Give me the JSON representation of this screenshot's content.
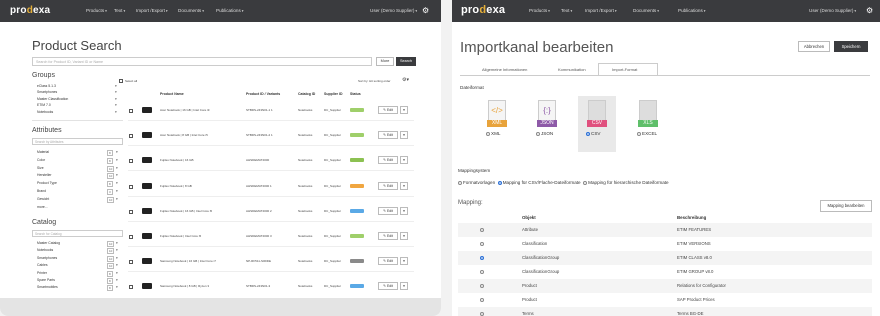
{
  "left": {
    "nav": {
      "logo_a": "pro",
      "logo_b": "d",
      "logo_c": "exa",
      "items": [
        "Products",
        "Text",
        "Import /Export",
        "Documents",
        "Publications"
      ],
      "user": "User (Demo Supplier)"
    },
    "title": "Product Search",
    "search_placeholder": "Search for Product ID, Variant ID or Name",
    "more_label": "More",
    "search_label": "Search",
    "groups_title": "Groups",
    "groups": [
      "eClass 5.1.3",
      "Smartphones",
      "Master Classification",
      "ETIM 7.0",
      "Notebooks"
    ],
    "attributes_title": "Attributes",
    "attr_search_placeholder": "Search by Attributes",
    "attributes": [
      {
        "name": "Material",
        "count": "8"
      },
      {
        "name": "Color",
        "count": "8"
      },
      {
        "name": "Size",
        "count": "10"
      },
      {
        "name": "Hersteller",
        "count": "10"
      },
      {
        "name": "Product Type",
        "count": "8"
      },
      {
        "name": "Brand",
        "count": "3"
      },
      {
        "name": "Gewicht",
        "count": "10"
      },
      {
        "name": "more...",
        "count": ""
      }
    ],
    "catalog_title": "Catalog",
    "catalog_search_placeholder": "Search for Catalog",
    "catalog": [
      {
        "name": "Master Catalog",
        "count": "10"
      },
      {
        "name": "Notebooks",
        "count": "10"
      },
      {
        "name": "Smartphones",
        "count": "10"
      },
      {
        "name": "Cables",
        "count": "10"
      },
      {
        "name": "Printer",
        "count": "8"
      },
      {
        "name": "Spare Parts",
        "count": "8"
      },
      {
        "name": "Smartmobiles",
        "count": "8"
      }
    ],
    "select_all": "Select all",
    "sort_label": "Sort by: Hit sorting order",
    "columns": {
      "name": "Product Name",
      "id": "Product ID / Variants",
      "catalog": "Catalog ID",
      "supplier": "Supplier ID",
      "status": "Status"
    },
    "rows": [
      {
        "name": "Acer Notebook | 16 GB | Intel Core i9",
        "id": "STBDS-243N01-1 1",
        "catalog": "Notebooks",
        "supplier": "DC_Supplier",
        "status_color": "#9fcf6a",
        "edit": "Edit"
      },
      {
        "name": "Acer Notebook | 8 GB | Intel Core i5",
        "id": "STBDS-243N01-2 1",
        "catalog": "Notebooks",
        "supplier": "DC_Supplier",
        "status_color": "#9fcf6a",
        "edit": "Edit"
      },
      {
        "name": "Fujitsu Notebook | 16 GB",
        "id": "AHSDEMAT2000",
        "catalog": "Notebooks",
        "supplier": "DC_Supplier",
        "status_color": "#8cc152",
        "edit": "Edit"
      },
      {
        "name": "Fujitsu Notebook | 8 GB",
        "id": "AHSDEMAT2000 1",
        "catalog": "Notebooks",
        "supplier": "DC_Supplier",
        "status_color": "#f0a640",
        "edit": "Edit"
      },
      {
        "name": "Fujitsu Notebook | 16 GB | Intel Core i5",
        "id": "AHSDEMAT2000 2",
        "catalog": "Notebooks",
        "supplier": "DC_Supplier",
        "status_color": "#5aa9e6",
        "edit": "Edit"
      },
      {
        "name": "Fujitsu Notebook | Intel Core i5",
        "id": "AHSDEMAT2000 3",
        "catalog": "Notebooks",
        "supplier": "DC_Supplier",
        "status_color": "#9fcf6a",
        "edit": "Edit"
      },
      {
        "name": "Samsung Notebook | 16 GB | Intel Core i7",
        "id": "NP-RF511-S0DDE",
        "catalog": "Notebooks",
        "supplier": "DC_Supplier",
        "status_color": "#8a8a8a",
        "edit": "Edit"
      },
      {
        "name": "Samsung Notebook | 8 GB | Ryzen 3",
        "id": "STBDS-243N01-3",
        "catalog": "Notebooks",
        "supplier": "DC_Supplier",
        "status_color": "#5aa9e6",
        "edit": "Edit"
      }
    ]
  },
  "right": {
    "nav": {
      "logo_a": "pro",
      "logo_b": "d",
      "logo_c": "exa",
      "items": [
        "Products",
        "Text",
        "Import /Export",
        "Documents",
        "Publications"
      ],
      "user": "User (Demo Supplier)"
    },
    "title": "Importkanal bearbeiten",
    "cancel_label": "Abbrechen",
    "save_label": "Speichern",
    "tabs": [
      "Allgemeine Informationen",
      "Kommunikation",
      "Import-Format"
    ],
    "dateiformat_label": "Dateiformat",
    "formats": [
      {
        "icon": "</>",
        "badge": "XML",
        "label": "XML",
        "color": "#e8a33b",
        "selected": false
      },
      {
        "icon": "{:}",
        "badge": "JSON",
        "label": "JSON",
        "color": "#8e5aa8",
        "selected": false
      },
      {
        "icon": "",
        "badge": "CSV",
        "label": "CSV",
        "color": "#e0507e",
        "selected": true
      },
      {
        "icon": "",
        "badge": "XLS",
        "label": "EXCEL",
        "color": "#5fbf6a",
        "selected": false
      }
    ],
    "mappingsystem_label": "Mappingsystem",
    "mapping_options": [
      "Formatvorlagen",
      "Mapping für CSV/Flache-Dateiformate",
      "Mapping für hierarchische Dateiformate"
    ],
    "mapping_label": "Mapping:",
    "mapping_edit_label": "Mapping bearbeiten",
    "mapping_cols": {
      "object": "Objekt",
      "description": "Beschreibung"
    },
    "mapping_rows": [
      {
        "object": "Attribute",
        "description": "ETIM FEATURES",
        "selected": false
      },
      {
        "object": "Classification",
        "description": "ETIM VERSIONS",
        "selected": false
      },
      {
        "object": "ClassificationGroup",
        "description": "ETIM CLASS v8.0",
        "selected": true
      },
      {
        "object": "ClassificationGroup",
        "description": "ETIM GROUP v8.0",
        "selected": false
      },
      {
        "object": "Product",
        "description": "Relations for Configurator",
        "selected": false
      },
      {
        "object": "Product",
        "description": "SAP Product Prices",
        "selected": false
      },
      {
        "object": "Terms",
        "description": "Terms BG-DE",
        "selected": false
      }
    ]
  }
}
